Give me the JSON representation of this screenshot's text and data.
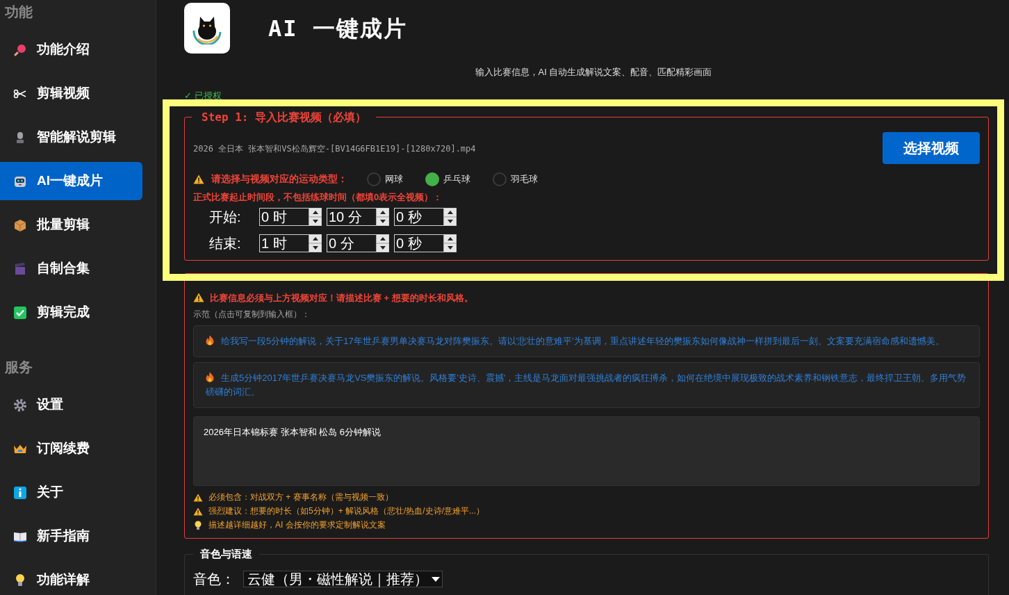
{
  "sidebar": {
    "sections": [
      {
        "title": "功能",
        "items": [
          {
            "label": "功能介绍",
            "selected": false
          },
          {
            "label": "剪辑视频",
            "selected": false
          },
          {
            "label": "智能解说剪辑",
            "selected": false
          },
          {
            "label": "AI一键成片",
            "selected": true
          },
          {
            "label": "批量剪辑",
            "selected": false
          },
          {
            "label": "自制合集",
            "selected": false
          },
          {
            "label": "剪辑完成",
            "selected": false
          }
        ]
      },
      {
        "title": "服务",
        "items": [
          {
            "label": "设置",
            "selected": false
          },
          {
            "label": "订阅续费",
            "selected": false
          },
          {
            "label": "关于",
            "selected": false
          },
          {
            "label": "新手指南",
            "selected": false
          },
          {
            "label": "功能详解",
            "selected": false
          }
        ]
      }
    ]
  },
  "header": {
    "title": "AI 一键成片",
    "subtitle": "输入比赛信息，AI 自动生成解说文案、配音、匹配精彩画面",
    "license": "✓ 已授权"
  },
  "step1": {
    "legend": "Step 1: 导入比赛视频（必填）",
    "file_name": "2026 全日本 张本智和VS松岛辉空-[BV14G6FB1E19]-[1280x720].mp4",
    "button": "选择视频",
    "sport_label": "请选择与视频对应的运动类型：",
    "sports": [
      {
        "label": "网球",
        "selected": false
      },
      {
        "label": "乒乓球",
        "selected": true
      },
      {
        "label": "羽毛球",
        "selected": false
      }
    ],
    "time_hint": "正式比赛起止时间段，不包括练球时间（都填0表示全视频）：",
    "time_rows": [
      {
        "label": "开始:",
        "fields": [
          "0 时",
          "10 分",
          "0 秒"
        ]
      },
      {
        "label": "结束:",
        "fields": [
          "1 时",
          "0 分",
          "0 秒"
        ]
      }
    ]
  },
  "step2": {
    "warning": "比赛信息必须与上方视频对应！请描述比赛 + 想要的时长和风格。",
    "examples_label": "示范（点击可复制到输入框）：",
    "examples": [
      "给我写一段5分钟的解说，关于17年世乒赛男单决赛马龙对阵樊振东。请以'悲壮的意难平'为基调，重点讲述年轻的樊振东如何像战神一样拼到最后一刻。文案要充满宿命感和遗憾美。",
      "生成5分钟2017年世乒赛决赛马龙VS樊振东的解说。风格要'史诗、震撼'，主线是马龙面对最强挑战者的疯狂搏杀，如何在绝境中展现极致的战术素养和钢铁意志，最终捍卫王朝。多用气势磅礴的词汇。"
    ],
    "input_value": "2026年日本锦标赛 张本智和 松岛 6分钟解说",
    "notes": [
      {
        "kind": "warning",
        "text": "必须包含：对战双方 + 赛事名称（需与视频一致）"
      },
      {
        "kind": "warning",
        "text": "强烈建议：想要的时长（如5分钟）+ 解说风格（悲壮/热血/史诗/意难平...）"
      },
      {
        "kind": "tip",
        "text": "描述越详细越好，AI 会按你的要求定制解说文案"
      }
    ]
  },
  "voice": {
    "legend": "音色与语速",
    "label": "音色：",
    "value": "云健（男・磁性解说｜推荐）"
  }
}
